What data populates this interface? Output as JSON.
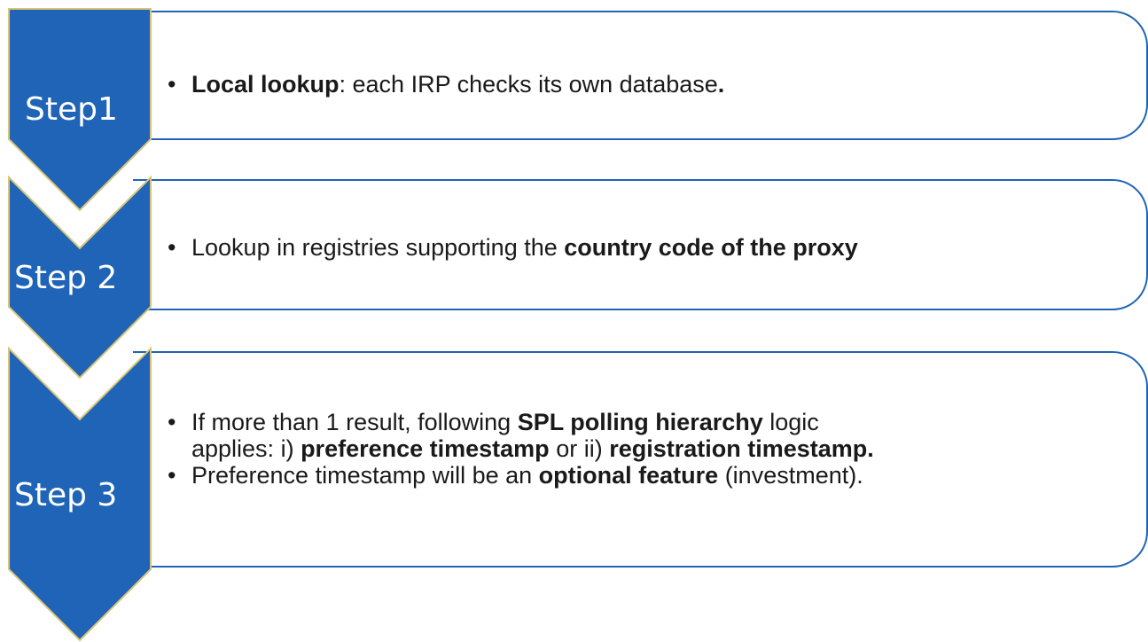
{
  "colors": {
    "chevron_fill": "#1f64b7",
    "chevron_edge": "#d9c37a",
    "box_border": "#1f64b7",
    "text": "#1a1a1a",
    "label_text": "#ffffff"
  },
  "steps": [
    {
      "label": "Step1",
      "lines": [
        [
          {
            "text": "Local lookup",
            "bold": true
          },
          {
            "text": ": each IRP checks its own database",
            "bold": false
          },
          {
            "text": ".",
            "bold": true
          }
        ]
      ]
    },
    {
      "label": "Step 2",
      "lines": [
        [
          {
            "text": "Lookup in registries supporting the ",
            "bold": false
          },
          {
            "text": "country code of the proxy",
            "bold": true
          }
        ]
      ]
    },
    {
      "label": "Step 3",
      "lines": [
        [
          {
            "text": "If more than 1 result, following ",
            "bold": false
          },
          {
            "text": "SPL polling hierarchy",
            "bold": true
          },
          {
            "text": " logic applies: i) ",
            "bold": false
          },
          {
            "text": "preference timestamp",
            "bold": true
          },
          {
            "text": " or ii) ",
            "bold": false
          },
          {
            "text": "registration timestamp.",
            "bold": true
          }
        ],
        [
          {
            "text": "Preference timestamp will be an ",
            "bold": false
          },
          {
            "text": "optional feature",
            "bold": true
          },
          {
            "text": " (investment).",
            "bold": false
          }
        ]
      ]
    }
  ]
}
